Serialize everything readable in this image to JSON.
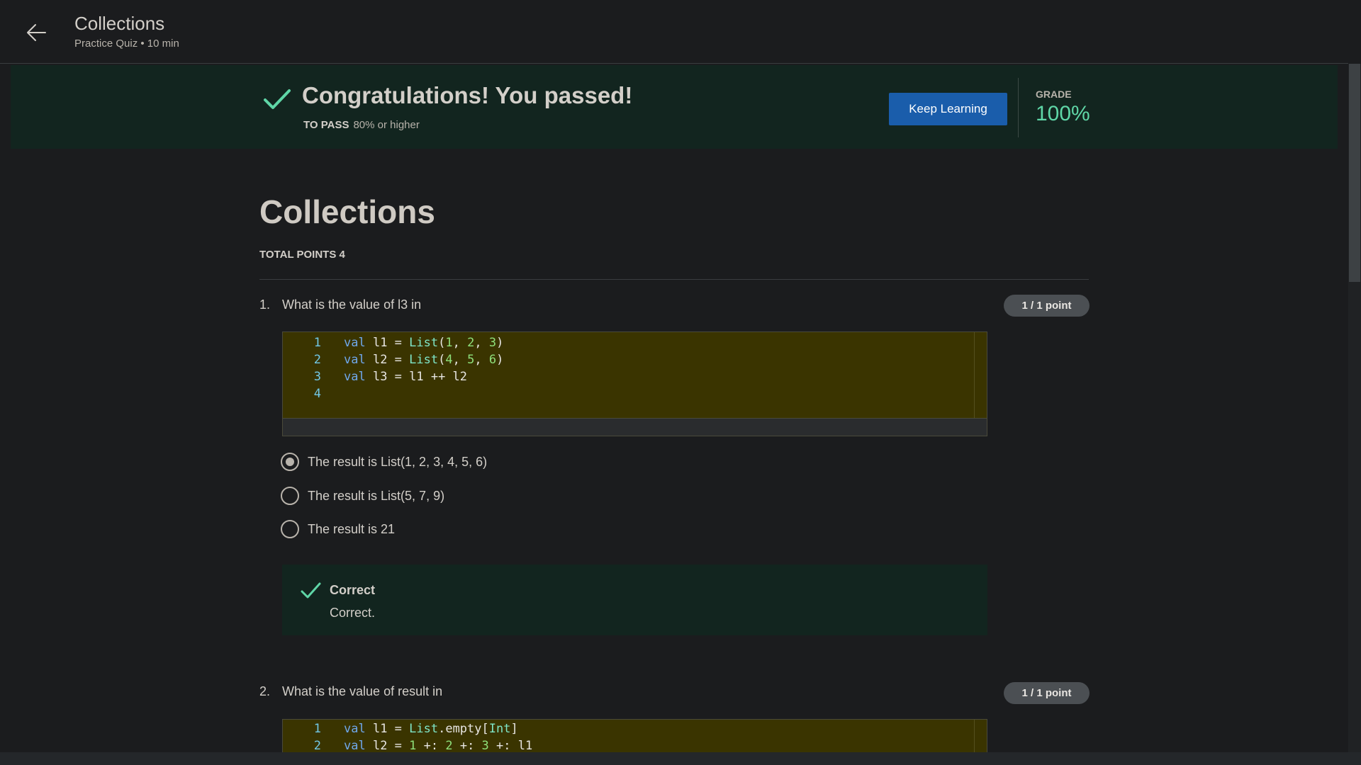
{
  "header": {
    "title": "Collections",
    "subtitle": "Practice Quiz • 10 min"
  },
  "banner": {
    "title": "Congratulations! You passed!",
    "to_pass_label": "TO PASS",
    "to_pass_value": "80% or higher",
    "keep_learning_label": "Keep Learning",
    "grade_label": "GRADE",
    "grade_value": "100%"
  },
  "main": {
    "title": "Collections",
    "total_points": "TOTAL POINTS 4"
  },
  "questions": [
    {
      "number": "1.",
      "text": "What is the value of l3 in",
      "points": "1 / 1 point",
      "code_line_numbers": [
        "1",
        "2",
        "3",
        "4"
      ],
      "options": [
        "The result is List(1, 2, 3, 4, 5, 6)",
        "The result is List(5, 7, 9)",
        "The result is 21"
      ],
      "selected_option": 0,
      "feedback": {
        "title": "Correct",
        "text": "Correct."
      }
    },
    {
      "number": "2.",
      "text": "What is the value of result in",
      "points": "1 / 1 point",
      "code_line_numbers": [
        "1",
        "2"
      ]
    }
  ],
  "colors": {
    "background": "#1b1c1e",
    "banner_bg": "#12251f",
    "accent_green": "#5fd6a7",
    "button_blue": "#1a5dab",
    "code_bg": "#3a3400"
  },
  "icons": {
    "back": "arrow-left-icon",
    "pass": "check-icon"
  }
}
